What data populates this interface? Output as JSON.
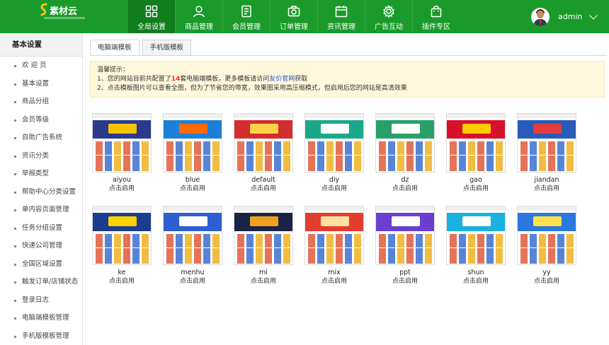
{
  "app": {
    "logo_text": "素材云",
    "user_name": "admin"
  },
  "nav": {
    "items": [
      {
        "label": "全局设置",
        "icon": "grid-icon",
        "active": true
      },
      {
        "label": "商品管理",
        "icon": "user-icon",
        "active": false
      },
      {
        "label": "会员管理",
        "icon": "document-icon",
        "active": false
      },
      {
        "label": "订单管理",
        "icon": "camera-icon",
        "active": false
      },
      {
        "label": "资讯管理",
        "icon": "calendar-icon",
        "active": false
      },
      {
        "label": "广告互动",
        "icon": "gear-icon",
        "active": false
      },
      {
        "label": "插件专区",
        "icon": "shopping-bag-icon",
        "active": false
      }
    ]
  },
  "sidebar": {
    "title": "基本设置",
    "items": [
      {
        "label": "欢 迎 页"
      },
      {
        "label": "基本设置"
      },
      {
        "label": "商品分组"
      },
      {
        "label": "会员等级"
      },
      {
        "label": "自助广告系统"
      },
      {
        "label": "资讯分类"
      },
      {
        "label": "举报类型"
      },
      {
        "label": "帮助中心分类设置"
      },
      {
        "label": "单内容页面管理"
      },
      {
        "label": "任务分组设置"
      },
      {
        "label": "快递公司管理"
      },
      {
        "label": "全国区域设置"
      },
      {
        "label": "触发订单/店铺状态"
      },
      {
        "label": "登录日志"
      },
      {
        "label": "电脑端模板管理"
      },
      {
        "label": "手机版模板管理"
      }
    ]
  },
  "tabs": [
    {
      "label": "电脑端模板",
      "active": true
    },
    {
      "label": "手机版模板",
      "active": false
    }
  ],
  "notice": {
    "title": "温馨提示：",
    "line1_prefix": "1、您的网站目前共配置了",
    "line1_count": "14",
    "line1_mid": "套电脑端模板，更多模板请访问",
    "line1_link": "友价官网",
    "line1_suffix": "获取",
    "line2": "2、点击模板图片可以查看全图，但为了节省您的带宽，效果图采用高压缩模式，但启用后您的网站是高清效果"
  },
  "templates": {
    "action_label": "点击启用",
    "items": [
      {
        "name": "aiyou",
        "color": "#2b3a8c",
        "accent": "#f5c400"
      },
      {
        "name": "blue",
        "color": "#1e7fd6",
        "accent": "#ff6a00"
      },
      {
        "name": "default",
        "color": "#d42d2d",
        "accent": "#ffd24a"
      },
      {
        "name": "diy",
        "color": "#1aa88a",
        "accent": "#ffffff"
      },
      {
        "name": "dz",
        "color": "#27a06a",
        "accent": "#ffffff"
      },
      {
        "name": "gao",
        "color": "#d8102a",
        "accent": "#ffcc00"
      },
      {
        "name": "jiandan",
        "color": "#2a5bb8",
        "accent": "#e23c3c"
      },
      {
        "name": "ke",
        "color": "#1a3d8f",
        "accent": "#ffd100"
      },
      {
        "name": "menhu",
        "color": "#2e5fd0",
        "accent": "#ffffff"
      },
      {
        "name": "mi",
        "color": "#1a2448",
        "accent": "#f0a020"
      },
      {
        "name": "mix",
        "color": "#e23d2d",
        "accent": "#ffe0a0"
      },
      {
        "name": "ppt",
        "color": "#6a3fd0",
        "accent": "#ffffff"
      },
      {
        "name": "shun",
        "color": "#1ab0e0",
        "accent": "#ffffff"
      },
      {
        "name": "yy",
        "color": "#2a78e0",
        "accent": "#ffe24a"
      }
    ]
  }
}
